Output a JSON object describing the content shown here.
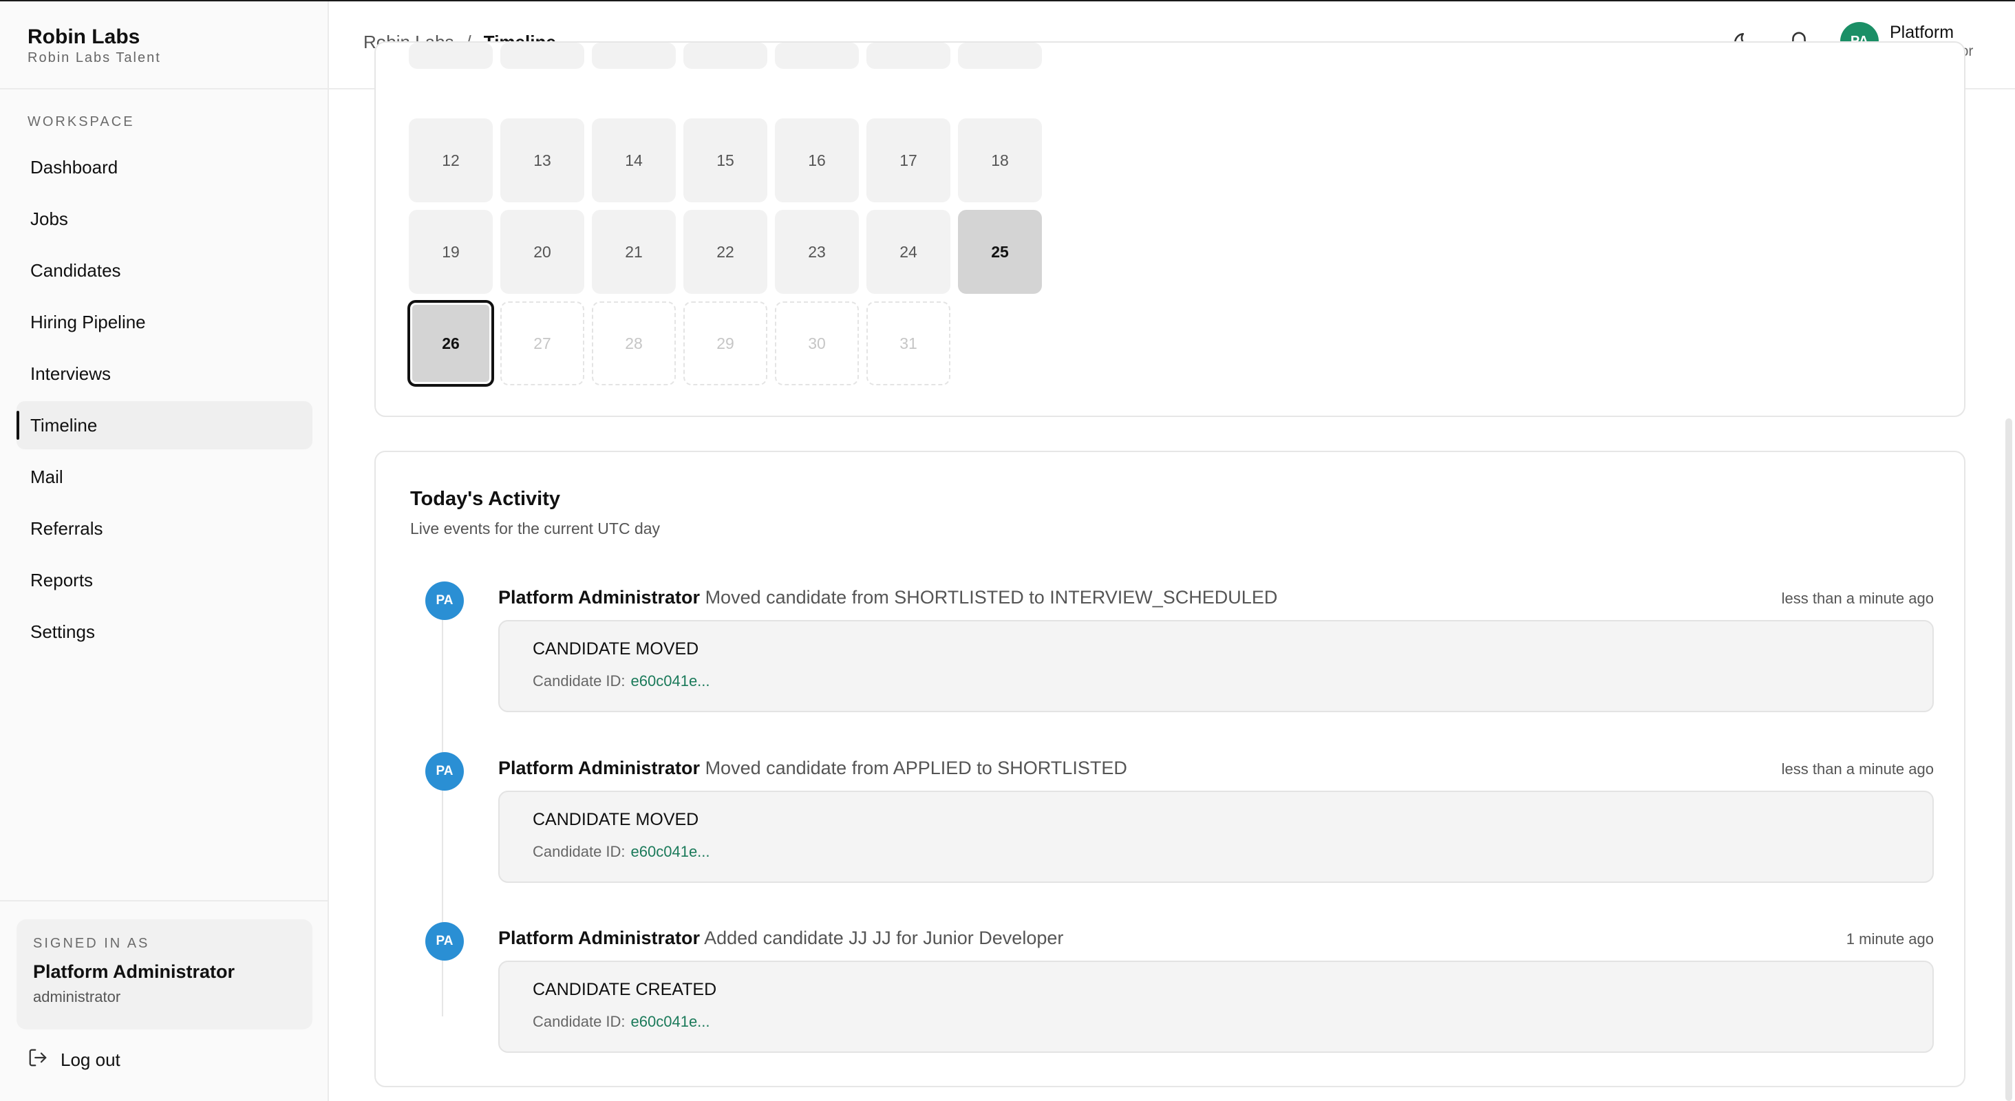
{
  "brand": {
    "title": "Robin Labs",
    "subtitle": "Robin Labs Talent"
  },
  "sidebar": {
    "section_label": "WORKSPACE",
    "items": [
      {
        "label": "Dashboard"
      },
      {
        "label": "Jobs"
      },
      {
        "label": "Candidates"
      },
      {
        "label": "Hiring Pipeline"
      },
      {
        "label": "Interviews"
      },
      {
        "label": "Timeline",
        "active": true
      },
      {
        "label": "Mail"
      },
      {
        "label": "Referrals"
      },
      {
        "label": "Reports"
      },
      {
        "label": "Settings"
      }
    ],
    "signed_in": {
      "label": "SIGNED IN AS",
      "name": "Platform Administrator",
      "role": "administrator"
    },
    "logout_label": "Log out"
  },
  "header": {
    "breadcrumb": {
      "root": "Robin Labs",
      "separator": "/",
      "current": "Timeline"
    },
    "user": {
      "initials": "PA",
      "name": "Platform",
      "role": "administrator"
    }
  },
  "calendar": {
    "prev_row_days": [
      "",
      "",
      "",
      "",
      "",
      "",
      ""
    ],
    "weeks": [
      [
        "12",
        "13",
        "14",
        "15",
        "16",
        "17",
        "18"
      ],
      [
        "19",
        "20",
        "21",
        "22",
        "23",
        "24",
        "25"
      ],
      [
        "26",
        "27",
        "28",
        "29",
        "30",
        "31"
      ]
    ],
    "selected_day": "25",
    "today": "26",
    "future_days": [
      "27",
      "28",
      "29",
      "30",
      "31"
    ]
  },
  "activity": {
    "title": "Today's Activity",
    "subtitle": "Live events for the current UTC day",
    "events": [
      {
        "initials": "PA",
        "actor": "Platform Administrator",
        "description": "Moved candidate from SHORTLISTED to INTERVIEW_SCHEDULED",
        "time": "less than a minute ago",
        "type": "CANDIDATE MOVED",
        "meta_label": "Candidate ID:",
        "meta_value": "e60c041e..."
      },
      {
        "initials": "PA",
        "actor": "Platform Administrator",
        "description": "Moved candidate from APPLIED to SHORTLISTED",
        "time": "less than a minute ago",
        "type": "CANDIDATE MOVED",
        "meta_label": "Candidate ID:",
        "meta_value": "e60c041e..."
      },
      {
        "initials": "PA",
        "actor": "Platform Administrator",
        "description": "Added candidate JJ JJ for Junior Developer",
        "time": "1 minute ago",
        "type": "CANDIDATE CREATED",
        "meta_label": "Candidate ID:",
        "meta_value": "e60c041e..."
      }
    ]
  },
  "colors": {
    "accent": "#1b8f66",
    "event_avatar": "#2a8fd4",
    "link": "#1b7a5a"
  },
  "icons": [
    "moon-icon",
    "bell-icon",
    "logout-icon"
  ]
}
